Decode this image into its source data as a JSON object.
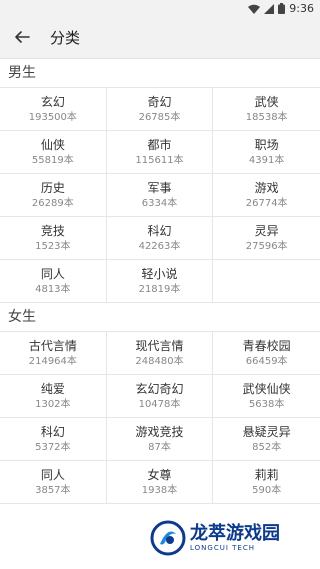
{
  "status_bar": {
    "time": "9:36",
    "icons": [
      "wifi-icon",
      "signal-icon",
      "battery-icon"
    ]
  },
  "app_bar": {
    "title": "分类",
    "back_icon": "arrow-left-icon"
  },
  "sections": [
    {
      "title": "男生",
      "items": [
        {
          "name": "玄幻",
          "count": "193500本"
        },
        {
          "name": "奇幻",
          "count": "26785本"
        },
        {
          "name": "武侠",
          "count": "18538本"
        },
        {
          "name": "仙侠",
          "count": "55819本"
        },
        {
          "name": "都市",
          "count": "115611本"
        },
        {
          "name": "职场",
          "count": "4391本"
        },
        {
          "name": "历史",
          "count": "26289本"
        },
        {
          "name": "军事",
          "count": "6334本"
        },
        {
          "name": "游戏",
          "count": "26774本"
        },
        {
          "name": "竞技",
          "count": "1523本"
        },
        {
          "name": "科幻",
          "count": "42263本"
        },
        {
          "name": "灵异",
          "count": "27596本"
        },
        {
          "name": "同人",
          "count": "4813本"
        },
        {
          "name": "轻小说",
          "count": "21819本"
        }
      ]
    },
    {
      "title": "女生",
      "items": [
        {
          "name": "古代言情",
          "count": "214964本"
        },
        {
          "name": "现代言情",
          "count": "248480本"
        },
        {
          "name": "青春校园",
          "count": "66459本"
        },
        {
          "name": "纯爱",
          "count": "1302本"
        },
        {
          "name": "玄幻奇幻",
          "count": "10478本"
        },
        {
          "name": "武侠仙侠",
          "count": "5638本"
        },
        {
          "name": "科幻",
          "count": "5372本"
        },
        {
          "name": "游戏竞技",
          "count": "87本"
        },
        {
          "name": "悬疑灵异",
          "count": "852本"
        },
        {
          "name": "同人",
          "count": "3857本"
        },
        {
          "name": "女尊",
          "count": "1938本"
        },
        {
          "name": "莉莉",
          "count": "590本"
        }
      ]
    }
  ],
  "watermark": {
    "main": "龙萃游戏园",
    "sub": "LONGCUI TECH"
  }
}
